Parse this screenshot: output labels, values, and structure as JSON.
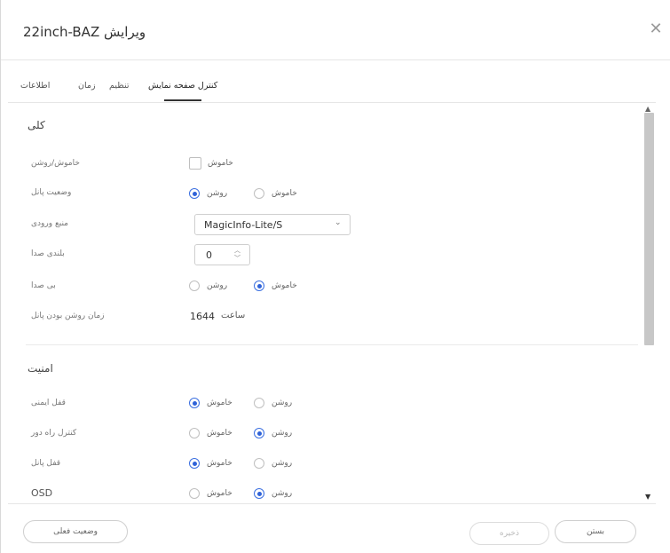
{
  "dialog": {
    "title": "ویرایش 22inch-BAZ",
    "close_icon": "close-icon"
  },
  "tabs": [
    {
      "label": "اطلاعات"
    },
    {
      "label": "زمان"
    },
    {
      "label": "تنظیم"
    },
    {
      "label": "کنترل صفحه نمایش",
      "active": true
    }
  ],
  "sections": {
    "general": {
      "title": "کلی",
      "power": {
        "label": "خاموش/روشن",
        "checkbox_label": "خاموش",
        "checked": false
      },
      "panel_status": {
        "label": "وضعیت پانل",
        "on_label": "روشن",
        "off_label": "خاموش",
        "selected": "on"
      },
      "input_source": {
        "label": "منبع ورودی",
        "value": "MagicInfo-Lite/S"
      },
      "volume": {
        "label": "بلندی صدا",
        "value": "0"
      },
      "mute": {
        "label": "بی صدا",
        "on_label": "روشن",
        "off_label": "خاموش",
        "selected": "off"
      },
      "panel_on_time": {
        "label": "زمان روشن بودن پانل",
        "value": "1644",
        "unit": "ساعت"
      }
    },
    "security": {
      "title": "امنیت",
      "safety_lock": {
        "label": "قفل ایمنی",
        "on_label": "روشن",
        "off_label": "خاموش",
        "selected": "off"
      },
      "remote_control": {
        "label": "کنترل راه دور",
        "on_label": "روشن",
        "off_label": "خاموش",
        "selected": "on"
      },
      "panel_lock": {
        "label": "قفل پانل",
        "on_label": "روشن",
        "off_label": "خاموش",
        "selected": "off"
      },
      "osd": {
        "label": "OSD",
        "on_label": "روشن",
        "off_label": "خاموش",
        "selected": "on"
      }
    }
  },
  "footer": {
    "current_status": "وضعیت فعلی",
    "save": "ذخیره",
    "close": "بستن"
  },
  "colors": {
    "accent": "#2f62d8",
    "thumb": "#c7c7c7"
  }
}
